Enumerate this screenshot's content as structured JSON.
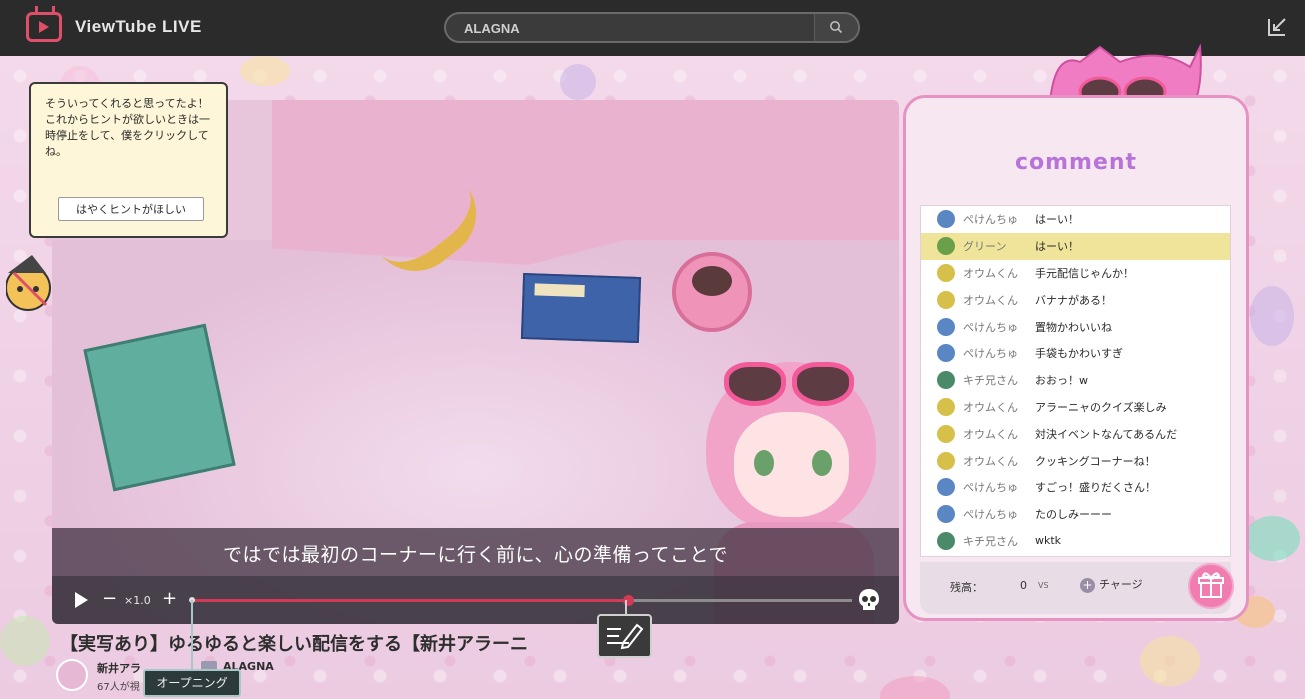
{
  "app": {
    "name": "ViewTube  LIVE"
  },
  "search": {
    "value": "ALAGNA"
  },
  "icons": {
    "logo": "tv-logo-icon",
    "search": "search-icon",
    "exit": "exit-icon",
    "play": "play-icon",
    "skull": "skull-icon",
    "memo": "memo-pen-icon",
    "gift": "gift-icon",
    "charge": "plus-circle-icon"
  },
  "colors": {
    "accent": "#d23a55",
    "panel_border": "#e692c2",
    "comment_header": "#b873d8",
    "highlight_row": "#efe49a"
  },
  "hint": {
    "text": "そういってくれると思ってたよ！\nこれからヒントが欲しいときは一時停止をして、僕をクリックしてね。",
    "button_label": "はやくヒントがほしい"
  },
  "player": {
    "subtitle": "ではでは最初のコーナーに行く前に、心の準備ってことで",
    "minus": "−",
    "plus": "+",
    "speed": "×1.0",
    "progress": 0.66,
    "chapter_markers": [
      0.0,
      0.66
    ]
  },
  "video_info": {
    "title": "【実写あり】ゆるゆると楽しい配信をする【新井アラーニ",
    "channel_name": "新井アラ",
    "viewers": "67人が視",
    "channel_tag": "ALAGNA",
    "chapter_tooltip": "オープニング"
  },
  "comments": {
    "header": "comment",
    "items": [
      {
        "user": "ぺけんちゅ",
        "text": "はーい！",
        "avatar_color": "#5b86c4",
        "highlight": false
      },
      {
        "user": "グリーン",
        "text": "はーい！",
        "avatar_color": "#6aa04a",
        "highlight": true
      },
      {
        "user": "オウムくん",
        "text": "手元配信じゃんか！",
        "avatar_color": "#d6c04a",
        "highlight": false
      },
      {
        "user": "オウムくん",
        "text": "バナナがある！",
        "avatar_color": "#d6c04a",
        "highlight": false
      },
      {
        "user": "ぺけんちゅ",
        "text": "置物かわいいね",
        "avatar_color": "#5b86c4",
        "highlight": false
      },
      {
        "user": "ぺけんちゅ",
        "text": "手袋もかわいすぎ",
        "avatar_color": "#5b86c4",
        "highlight": false
      },
      {
        "user": "キチ兄さん",
        "text": "おおっ！w",
        "avatar_color": "#4a8a6a",
        "highlight": false
      },
      {
        "user": "オウムくん",
        "text": "アラーニャのクイズ楽しみ",
        "avatar_color": "#d6c04a",
        "highlight": false
      },
      {
        "user": "オウムくん",
        "text": "対決イベントなんてあるんだ",
        "avatar_color": "#d6c04a",
        "highlight": false
      },
      {
        "user": "オウムくん",
        "text": "クッキングコーナーね！",
        "avatar_color": "#d6c04a",
        "highlight": false
      },
      {
        "user": "ぺけんちゅ",
        "text": "すごっ！盛りだくさん！",
        "avatar_color": "#5b86c4",
        "highlight": false
      },
      {
        "user": "ぺけんちゅ",
        "text": "たのしみーーー",
        "avatar_color": "#5b86c4",
        "highlight": false
      },
      {
        "user": "キチ兄さん",
        "text": "wktk",
        "avatar_color": "#4a8a6a",
        "highlight": false
      }
    ]
  },
  "wallet": {
    "balance_label": "残高：",
    "balance_value": "0",
    "unit": "VS",
    "charge_label": "チャージ"
  }
}
